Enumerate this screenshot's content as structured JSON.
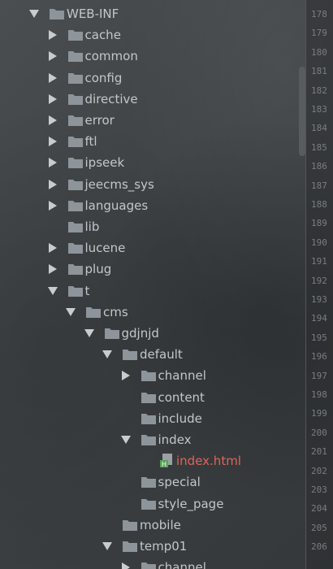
{
  "tree": [
    {
      "label": "WEB-INF",
      "level": 0,
      "arrow": "down",
      "icon": "folder"
    },
    {
      "label": "cache",
      "level": 1,
      "arrow": "right",
      "icon": "folder"
    },
    {
      "label": "common",
      "level": 1,
      "arrow": "right",
      "icon": "folder"
    },
    {
      "label": "config",
      "level": 1,
      "arrow": "right",
      "icon": "folder"
    },
    {
      "label": "directive",
      "level": 1,
      "arrow": "right",
      "icon": "folder"
    },
    {
      "label": "error",
      "level": 1,
      "arrow": "right",
      "icon": "folder"
    },
    {
      "label": "ftl",
      "level": 1,
      "arrow": "right",
      "icon": "folder"
    },
    {
      "label": "ipseek",
      "level": 1,
      "arrow": "right",
      "icon": "folder"
    },
    {
      "label": "jeecms_sys",
      "level": 1,
      "arrow": "right",
      "icon": "folder"
    },
    {
      "label": "languages",
      "level": 1,
      "arrow": "right",
      "icon": "folder"
    },
    {
      "label": "lib",
      "level": 1,
      "arrow": "none",
      "icon": "folder"
    },
    {
      "label": "lucene",
      "level": 1,
      "arrow": "right",
      "icon": "folder"
    },
    {
      "label": "plug",
      "level": 1,
      "arrow": "right",
      "icon": "folder"
    },
    {
      "label": "t",
      "level": 1,
      "arrow": "down",
      "icon": "folder"
    },
    {
      "label": "cms",
      "level": 2,
      "arrow": "down",
      "icon": "folder"
    },
    {
      "label": "gdjnjd",
      "level": 3,
      "arrow": "down",
      "icon": "folder"
    },
    {
      "label": "default",
      "level": 4,
      "arrow": "down",
      "icon": "folder"
    },
    {
      "label": "channel",
      "level": 5,
      "arrow": "right",
      "icon": "folder"
    },
    {
      "label": "content",
      "level": 5,
      "arrow": "none",
      "icon": "folder"
    },
    {
      "label": "include",
      "level": 5,
      "arrow": "none",
      "icon": "folder"
    },
    {
      "label": "index",
      "level": 5,
      "arrow": "down",
      "icon": "folder"
    },
    {
      "label": "index.html",
      "level": 6,
      "arrow": "none",
      "icon": "html-file",
      "highlight": "#e0635b"
    },
    {
      "label": "special",
      "level": 5,
      "arrow": "none",
      "icon": "folder"
    },
    {
      "label": "style_page",
      "level": 5,
      "arrow": "none",
      "icon": "folder"
    },
    {
      "label": "mobile",
      "level": 4,
      "arrow": "none",
      "icon": "folder"
    },
    {
      "label": "temp01",
      "level": 4,
      "arrow": "down",
      "icon": "folder"
    },
    {
      "label": "channel",
      "level": 5,
      "arrow": "right",
      "icon": "folder"
    }
  ],
  "line_numbers": [
    "178",
    "179",
    "180",
    "181",
    "182",
    "183",
    "184",
    "185",
    "186",
    "187",
    "188",
    "189",
    "190",
    "191",
    "192",
    "193",
    "194",
    "195",
    "196",
    "197",
    "198",
    "199",
    "200",
    "201",
    "202",
    "203",
    "204",
    "205",
    "206"
  ],
  "colors": {
    "folder": "#8d949a",
    "text": "#c3c7cb",
    "modified": "#e0635b",
    "html_icon": "#5aa25a"
  }
}
